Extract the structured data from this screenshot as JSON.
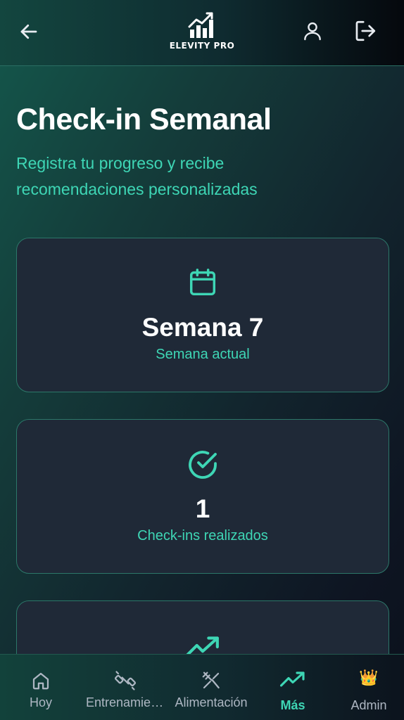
{
  "header": {
    "brand": "ELEVITY PRO",
    "icons": {
      "back": "arrow-left-icon",
      "user": "user-icon",
      "logout": "logout-icon",
      "logo": "bar-chart-trend-logo"
    }
  },
  "page": {
    "title": "Check-in Semanal",
    "subtitle": "Registra tu progreso y recibe recomendaciones personalizadas"
  },
  "cards": [
    {
      "icon": "calendar-icon",
      "value": "Semana 7",
      "label": "Semana actual"
    },
    {
      "icon": "check-circle-icon",
      "value": "1",
      "label": "Check-ins realizados"
    },
    {
      "icon": "trending-up-icon",
      "value": "",
      "label": ""
    }
  ],
  "nav": {
    "items": [
      {
        "label": "Hoy",
        "icon": "home-icon",
        "active": false
      },
      {
        "label": "Entrenamiento",
        "icon": "dumbbell-icon",
        "active": false
      },
      {
        "label": "Alimentación",
        "icon": "utensils-icon",
        "active": false
      },
      {
        "label": "Más",
        "icon": "trending-up-icon",
        "active": true
      },
      {
        "label": "Admin",
        "icon": "crown-icon",
        "active": false
      }
    ],
    "crown_glyph": "👑"
  },
  "colors": {
    "accent": "#3ed6b5",
    "card_bg": "#1f2937",
    "card_border": "#2c7769",
    "text_primary": "#ffffff",
    "text_muted": "#aeb7c3"
  }
}
